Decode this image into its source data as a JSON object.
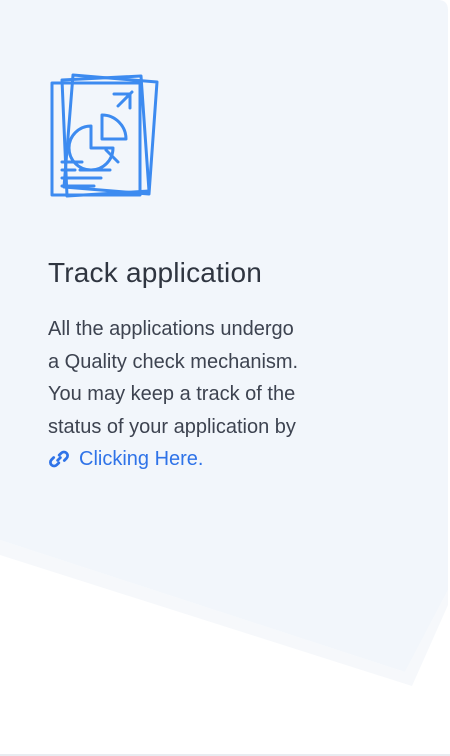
{
  "card": {
    "title": "Track application",
    "description": {
      "line1": "All the applications undergo",
      "line2": "a Quality check mechanism.",
      "line3": "You may keep a track of the",
      "line4": "status of your application by"
    },
    "link": {
      "label": "Clicking Here.",
      "icon": "link-icon"
    },
    "illustration_icon": "document-chart-icon"
  },
  "colors": {
    "accent": "#2f73e8",
    "icon_blue": "#3d8bf0",
    "panel_bg": "#f2f6fb",
    "title_text": "#2f3540",
    "body_text": "#3d4350"
  }
}
